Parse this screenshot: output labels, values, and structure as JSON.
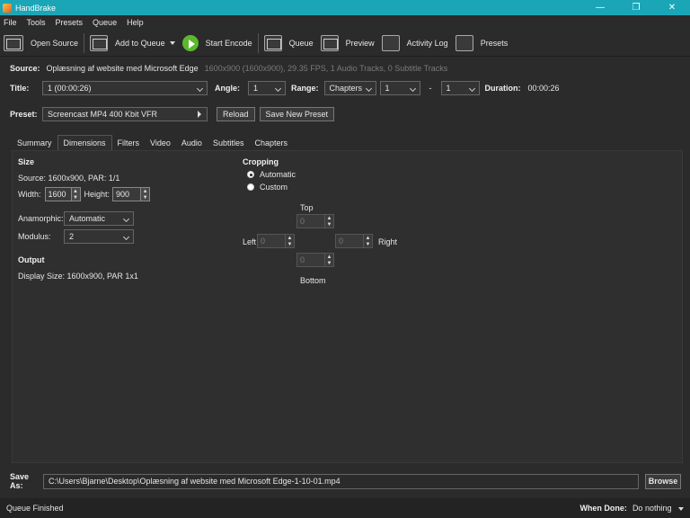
{
  "window": {
    "title": "HandBrake",
    "minimize": "—",
    "maximize": "❐",
    "close": "✕"
  },
  "menu": [
    "File",
    "Tools",
    "Presets",
    "Queue",
    "Help"
  ],
  "toolbar": {
    "open_source": "Open Source",
    "add_to_queue": "Add to Queue",
    "start_encode": "Start Encode",
    "queue": "Queue",
    "preview": "Preview",
    "activity_log": "Activity Log",
    "presets": "Presets"
  },
  "source": {
    "label": "Source:",
    "name": "Oplæsning af website med Microsoft Edge",
    "info": "1600x900 (1600x900), 29.35 FPS, 1 Audio Tracks, 0 Subtitle Tracks"
  },
  "title_row": {
    "title_label": "Title:",
    "title_value": "1  (00:00:26)",
    "angle_label": "Angle:",
    "angle_value": "1",
    "range_label": "Range:",
    "range_mode": "Chapters",
    "range_start": "1",
    "range_dash": "-",
    "range_end": "1",
    "duration_label": "Duration:",
    "duration_value": "00:00:26"
  },
  "preset_row": {
    "label": "Preset:",
    "value": "Screencast MP4 400 Kbit VFR",
    "reload": "Reload",
    "save_new": "Save New Preset"
  },
  "tabs": [
    "Summary",
    "Dimensions",
    "Filters",
    "Video",
    "Audio",
    "Subtitles",
    "Chapters"
  ],
  "size": {
    "heading": "Size",
    "source_line": "Source:   1600x900, PAR: 1/1",
    "width_label": "Width:",
    "width_value": "1600",
    "height_label": "Height:",
    "height_value": "900",
    "anamorphic_label": "Anamorphic:",
    "anamorphic_value": "Automatic",
    "modulus_label": "Modulus:",
    "modulus_value": "2"
  },
  "output": {
    "heading": "Output",
    "display_size": "Display Size: 1600x900,  PAR 1x1"
  },
  "cropping": {
    "heading": "Cropping",
    "automatic": "Automatic",
    "custom": "Custom",
    "top_label": "Top",
    "top_value": "0",
    "left_label": "Left",
    "left_value": "0",
    "right_label": "Right",
    "right_value": "0",
    "bottom_label": "Bottom",
    "bottom_value": "0"
  },
  "save_as": {
    "label": "Save As:",
    "path": "C:\\Users\\Bjarne\\Desktop\\Oplæsning af website med Microsoft Edge-1-10-01.mp4",
    "browse": "Browse"
  },
  "status": {
    "text": "Queue Finished",
    "when_done_label": "When Done:",
    "when_done_value": "Do nothing"
  }
}
